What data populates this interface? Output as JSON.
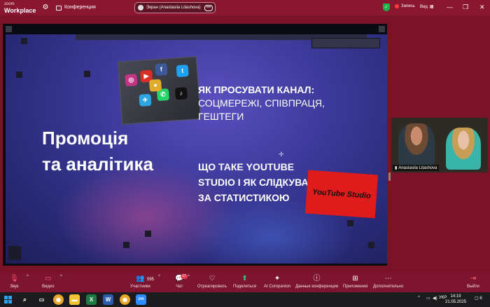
{
  "app": {
    "brand_small": "zoom",
    "brand_large": "Workplace"
  },
  "topbar": {
    "meeting_label": "Конференция",
    "screen_share_label": "Экран (Anastasiia Litashova)",
    "record_label": "Запись",
    "view_label": "Вид",
    "colors": {
      "bar": "#8a1630",
      "secure": "#22b04b",
      "record": "#ff3b3b"
    }
  },
  "slide": {
    "title_line1": "Промоція",
    "title_line2": "та аналітика",
    "point1_line1": "ЯК ПРОСУВАТИ КАНАЛ:",
    "point1_line2": "СОЦМЕРЕЖІ, СПІВПРАЦЯ,",
    "point1_line3": "ГЕШТЕГИ",
    "point2_line1": "ЩО ТАКЕ YOUTUBE",
    "point2_line2": "STUDIO І ЯК СЛІДКУВАТИ",
    "point2_line3": "ЗА СТАТИСТИКОЮ",
    "yt_badge_text": "YouTube Studio"
  },
  "camera": {
    "participant_name": "Anastasiia Litashova"
  },
  "toolbar": {
    "audio": "Звук",
    "video": "Видео",
    "participants": "Участники",
    "participants_count": "595",
    "chat": "Чат",
    "chat_badge": "17",
    "react": "Отреагировать",
    "share": "Поделиться",
    "ai": "AI Companion",
    "meeting_info": "Данные конференции",
    "apps": "Приложения",
    "more": "Дополнительно",
    "leave": "Выйти"
  },
  "taskbar": {
    "language": "УКР",
    "time": "14:19",
    "date": "21.05.2025",
    "notifications": "6"
  }
}
